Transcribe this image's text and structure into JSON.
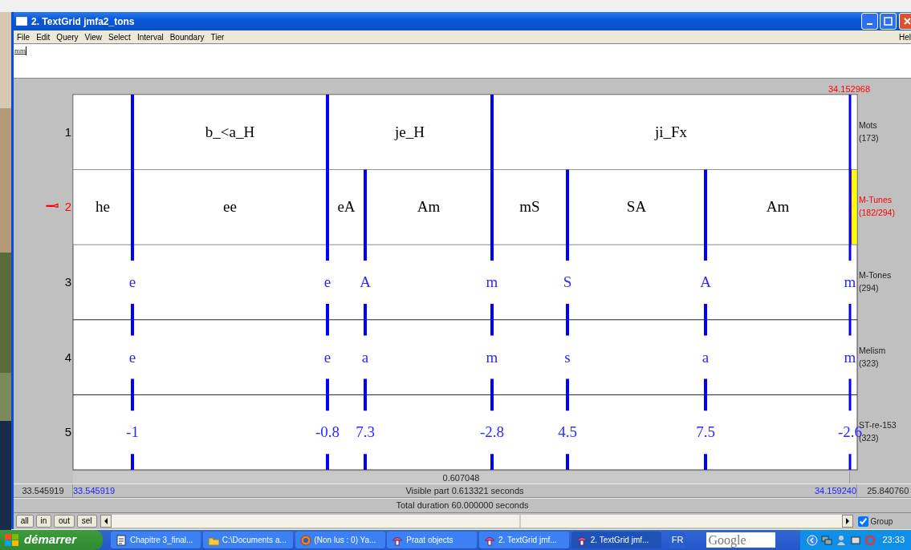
{
  "window": {
    "title": "2. TextGrid jmfa2_tons"
  },
  "menu": [
    "File",
    "Edit",
    "Query",
    "View",
    "Select",
    "Interval",
    "Boundary",
    "Tier"
  ],
  "help_menu": "Hel",
  "text_field": {
    "value": "mm"
  },
  "cursor_time": "34.152968",
  "tiers": [
    {
      "number": "1",
      "name": "Mots",
      "count": "(173)",
      "selected": false,
      "kind": "interval",
      "intervals": [
        {
          "selected": false
        },
        {
          "text": "b_<a_H",
          "selected": false
        },
        {
          "text": "je_H",
          "selected": false
        },
        {
          "text": "ji_Fx",
          "selected": false
        },
        {
          "selected": false
        }
      ]
    },
    {
      "number": "2",
      "name": "M-Tunes",
      "count": "(182/294)",
      "selected": true,
      "kind": "interval",
      "intervals": [
        {
          "text": "he",
          "selected": false
        },
        {
          "text": "ee",
          "selected": false
        },
        {
          "text": "eA",
          "selected": false
        },
        {
          "text": "Am",
          "selected": false
        },
        {
          "text": "mS",
          "selected": false
        },
        {
          "text": "SA",
          "selected": false
        },
        {
          "text": "Am",
          "selected": false
        },
        {
          "selected": true
        }
      ]
    },
    {
      "number": "3",
      "name": "M-Tones",
      "count": "(294)",
      "selected": false,
      "kind": "point",
      "points": [
        "e",
        "e",
        "A",
        "m",
        "S",
        "A",
        "m"
      ]
    },
    {
      "number": "4",
      "name": "Melism",
      "count": "(323)",
      "selected": false,
      "kind": "point",
      "points": [
        "e",
        "e",
        "a",
        "m",
        "s",
        "a",
        "m"
      ]
    },
    {
      "number": "5",
      "name": "ST-re-153",
      "count": "(323)",
      "selected": false,
      "kind": "point",
      "points": [
        "-1",
        "-0.8",
        "7.3",
        "-2.8",
        "4.5",
        "7.5",
        "-2.6"
      ]
    }
  ],
  "selection_duration": "0.607048",
  "status": {
    "window_start": "33.545919",
    "visible_start": "33.545919",
    "visible_part": "Visible part 0.613321 seconds",
    "visible_end": "34.159240",
    "remaining": "25.840760",
    "total_duration": "Total duration 60.000000 seconds"
  },
  "zoom_buttons": [
    "all",
    "in",
    "out",
    "sel"
  ],
  "group_checkbox": {
    "label": "Group",
    "checked": true
  },
  "taskbar": {
    "start": "démarrer",
    "tasks": [
      {
        "label": "Chapitre 3_final...",
        "kind": "document",
        "selected": false
      },
      {
        "label": "C:\\Documents a...",
        "kind": "folder",
        "selected": false
      },
      {
        "label": "(Non lus : 0) Ya...",
        "kind": "browser",
        "selected": false
      },
      {
        "label": "Praat objects",
        "kind": "praat",
        "selected": false
      },
      {
        "label": "2. TextGrid jmf...",
        "kind": "praat",
        "selected": false
      },
      {
        "label": "2. TextGrid jmf...",
        "kind": "praat",
        "selected": true
      }
    ],
    "language": "FR",
    "search_placeholder": "Google",
    "clock": "23:33"
  }
}
